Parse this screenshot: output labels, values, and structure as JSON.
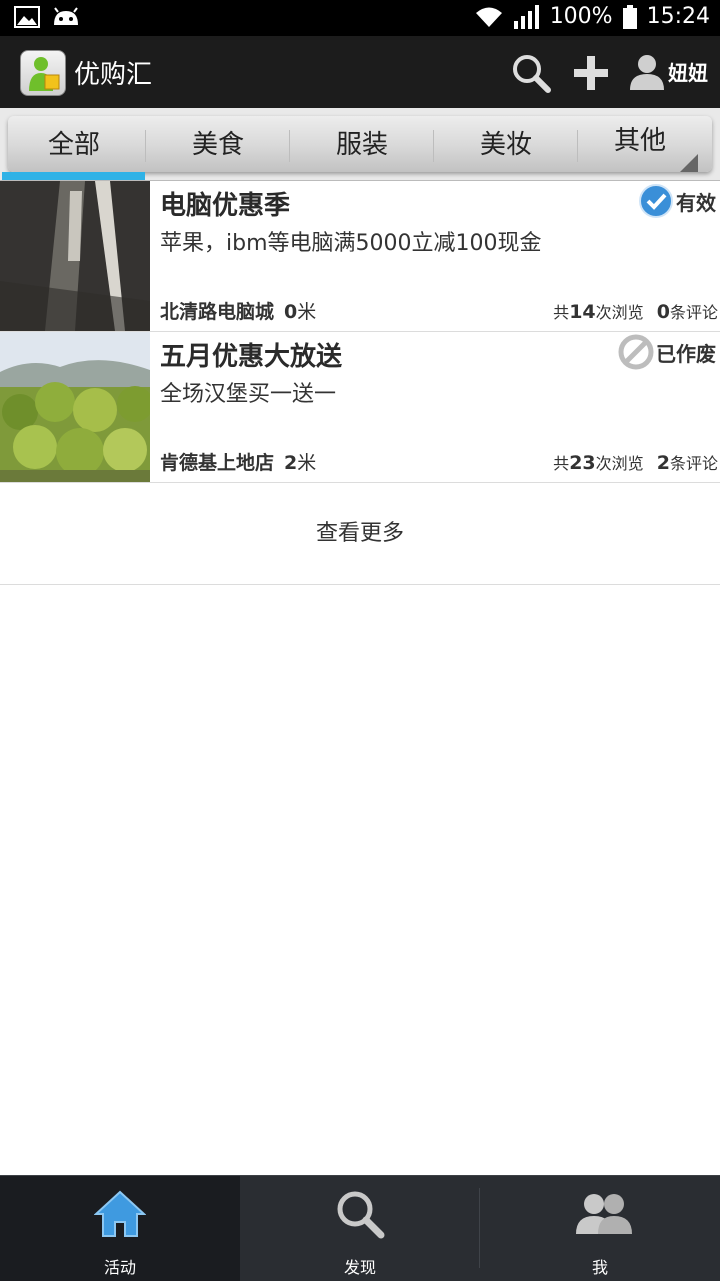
{
  "status_bar": {
    "battery": "100%",
    "time": "15:24"
  },
  "app": {
    "title": "优购汇",
    "user_name": "妞妞"
  },
  "tabs": [
    {
      "label": "全部",
      "active": true
    },
    {
      "label": "美食"
    },
    {
      "label": "服装"
    },
    {
      "label": "美妆"
    },
    {
      "label": "其他"
    }
  ],
  "list": [
    {
      "title": "电脑优惠季",
      "desc": "苹果，ibm等电脑满5000立减100现金",
      "status": "有效",
      "status_icon": "check-circle-icon",
      "store": "北清路电脑城",
      "distance_num": "0",
      "distance_unit": "米",
      "views_prefix": "共",
      "views": "14",
      "views_suffix": "次浏览",
      "comments": "0",
      "comments_suffix": "条评论"
    },
    {
      "title": "五月优惠大放送",
      "desc": "全场汉堡买一送一",
      "status": "已作废",
      "status_icon": "forbidden-icon",
      "store": "肯德基上地店",
      "distance_num": "2",
      "distance_unit": "米",
      "views_prefix": "共",
      "views": "23",
      "views_suffix": "次浏览",
      "comments": "2",
      "comments_suffix": "条评论"
    }
  ],
  "load_more": "查看更多",
  "bottom_nav": [
    {
      "label": "活动",
      "icon": "home-icon",
      "active": true
    },
    {
      "label": "发现",
      "icon": "search-icon"
    },
    {
      "label": "我",
      "icon": "people-icon"
    }
  ],
  "colors": {
    "accent": "#2fb2e6",
    "appbar": "#1c1c1c",
    "bottombar": "#2a2d32"
  }
}
